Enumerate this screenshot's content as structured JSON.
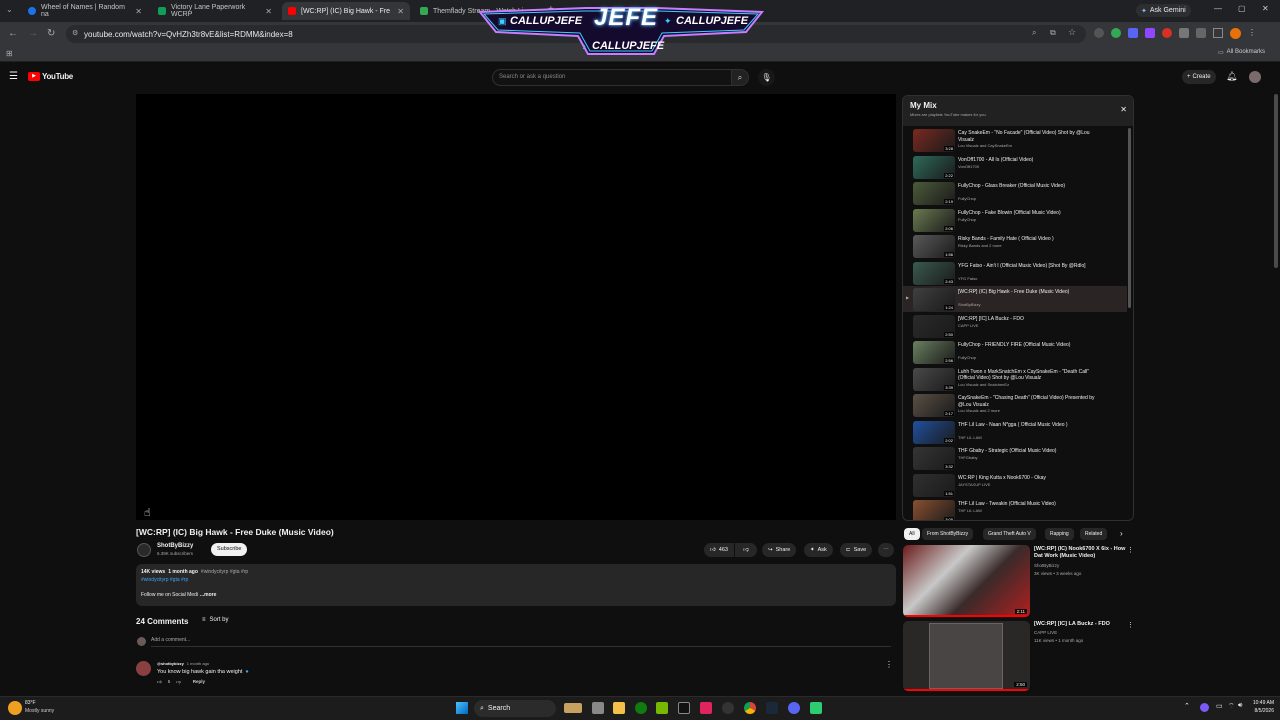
{
  "tabs": [
    {
      "label": "Wheel of Names | Random na",
      "color": "#1a73e8"
    },
    {
      "label": "Victory Lane Paperwork WCRP",
      "color": "#0f9d58"
    },
    {
      "label": "[WC:RP] (IC) Big Hawk - Fre",
      "color": "#ff0000"
    },
    {
      "label": "Themflady Stream - Watch Li",
      "color": "#34a853"
    }
  ],
  "browser": {
    "url": "youtube.com/watch?v=QvHZh3tr8vE&list=RDMM&index=8",
    "ask_gemini": "Ask Gemini",
    "all_bookmarks": "All Bookmarks"
  },
  "overlay": {
    "logo": "JEFE",
    "handle_left": "CALLUPJEFE",
    "handle_right": "CALLUPJEFE",
    "handle_bottom": "CALLUPJEFE"
  },
  "yt": {
    "logo": "YouTube",
    "search_placeholder": "Search or ask a question",
    "create_label": "Create"
  },
  "video": {
    "title": "[WC:RP] (IC) Big Hawk - Free Duke (Music Video)",
    "channel": "ShotByBizzy",
    "subscribers": "6.39K subscribers",
    "subscribe_label": "Subscribe",
    "likes": "463",
    "share_label": "Share",
    "ask_label": "Ask",
    "save_label": "Save",
    "views": "14K views",
    "age": "1 month ago",
    "tags_inline": "#windycityrp #gta #rp",
    "hashtags": "#windycityrp #gta #rp",
    "desc_line": "Follow me on Social Medi",
    "more_label": "...more"
  },
  "comments": {
    "count_label": "24 Comments",
    "sort_label": "Sort by",
    "add_placeholder": "Add a comment...",
    "items": [
      {
        "author": "@shotbybizzy",
        "age": "1 month ago",
        "text": "You know big hawk gain tha weight",
        "likes": "5",
        "reply_label": "Reply"
      }
    ]
  },
  "mix": {
    "title": "My Mix",
    "subtitle": "Mixes are playlists YouTube makes for you",
    "items": [
      {
        "title": "Cay SnakeEm - \"No Facade\" (Official Video) Shot by @Lou Visualz",
        "sub": "Lou Visualz and CaySnakeEm",
        "duration": "3:28",
        "color": "#7a2a20"
      },
      {
        "title": "VonOff1700 - All Is (Official Video)",
        "sub": "VonOff1700",
        "duration": "2:22",
        "color": "#2f6a5a"
      },
      {
        "title": "FullyChop - Glass Breaker (Official Music Video)",
        "sub": "FullyChop",
        "duration": "2:19",
        "color": "#4c5b3a"
      },
      {
        "title": "FullyChop - Fake Blowin (Official Music Video)",
        "sub": "FullyChop",
        "duration": "2:06",
        "color": "#6a7a50"
      },
      {
        "title": "Risky Bands - Family Hate ( Official Video )",
        "sub": "Risky Bands and 2 more",
        "duration": "1:56",
        "color": "#5a5a5a"
      },
      {
        "title": "YFG Fatso - Ain't I (Official Music Video) [Shot By @Rdlo]",
        "sub": "YFG Fatso",
        "duration": "2:43",
        "color": "#3a5a50"
      },
      {
        "title": "[WC:RP] (IC) Big Hawk - Free Duke (Music Video)",
        "sub": "ShotByBizzy",
        "duration": "1:24",
        "color": "#404040"
      },
      {
        "title": "[WC:RP] [IC] LA Buckz - FDO",
        "sub": "CAPP LIVE",
        "duration": "2:50",
        "color": "#2a2a2a"
      },
      {
        "title": "FullyChop - FRIENDLY FIRE (Official Music Video)",
        "sub": "FullyChop",
        "duration": "2:56",
        "color": "#6a8060"
      },
      {
        "title": "Luhh Twon x MarkSnatchEm x CaySnakeEm - \"Death Call\" (Official Video) Shot by @Lou Visualz",
        "sub": "Lou Visualz and SnatchenEz",
        "duration": "3:39",
        "color": "#4a4a4a"
      },
      {
        "title": "CaySnakeEm - \"Chasing Death\" (Official Video) Presented by @Lou Visualz",
        "sub": "Lou Visualz and 2 more",
        "duration": "2:17",
        "color": "#5a5045"
      },
      {
        "title": "THF Lil Law - Naan N*gga ( Official Music Video )",
        "sub": "THF LIL LAW",
        "duration": "2:02",
        "color": "#2050a0"
      },
      {
        "title": "THF Gbaby - Strategic (Official Music Video)",
        "sub": "THFGbaby",
        "duration": "3:32",
        "color": "#353535"
      },
      {
        "title": "WC:RP | King Kutta x Nook6700 - Okay",
        "sub": "JAYSTAXUP LIVE",
        "duration": "1:51",
        "color": "#303030"
      },
      {
        "title": "THF Lil Law - Tweakin (Official Music Video)",
        "sub": "THF LIL LAW",
        "duration": "3:05",
        "color": "#8a5030"
      }
    ]
  },
  "chips": [
    "All",
    "From ShotByBizzy",
    "Grand Theft Auto V",
    "Rapping",
    "Related"
  ],
  "related": [
    {
      "title": "[WC:RP] (IC) Nook6700 X 6ix - How Dat Work (Music Video)",
      "channel": "ShotByBizzy",
      "meta": "3K views • 3 weeks ago",
      "duration": "2:11"
    },
    {
      "title": "[WC:RP] [IC] LA Buckz - FDO",
      "channel": "CAPP LIVE",
      "meta": "11K views • 1 month ago",
      "duration": "2:50"
    }
  ],
  "taskbar": {
    "weather_temp": "83°F",
    "weather_desc": "Mostly sunny",
    "search_label": "Search",
    "time": "10:49 AM",
    "date": "8/5/2026"
  }
}
